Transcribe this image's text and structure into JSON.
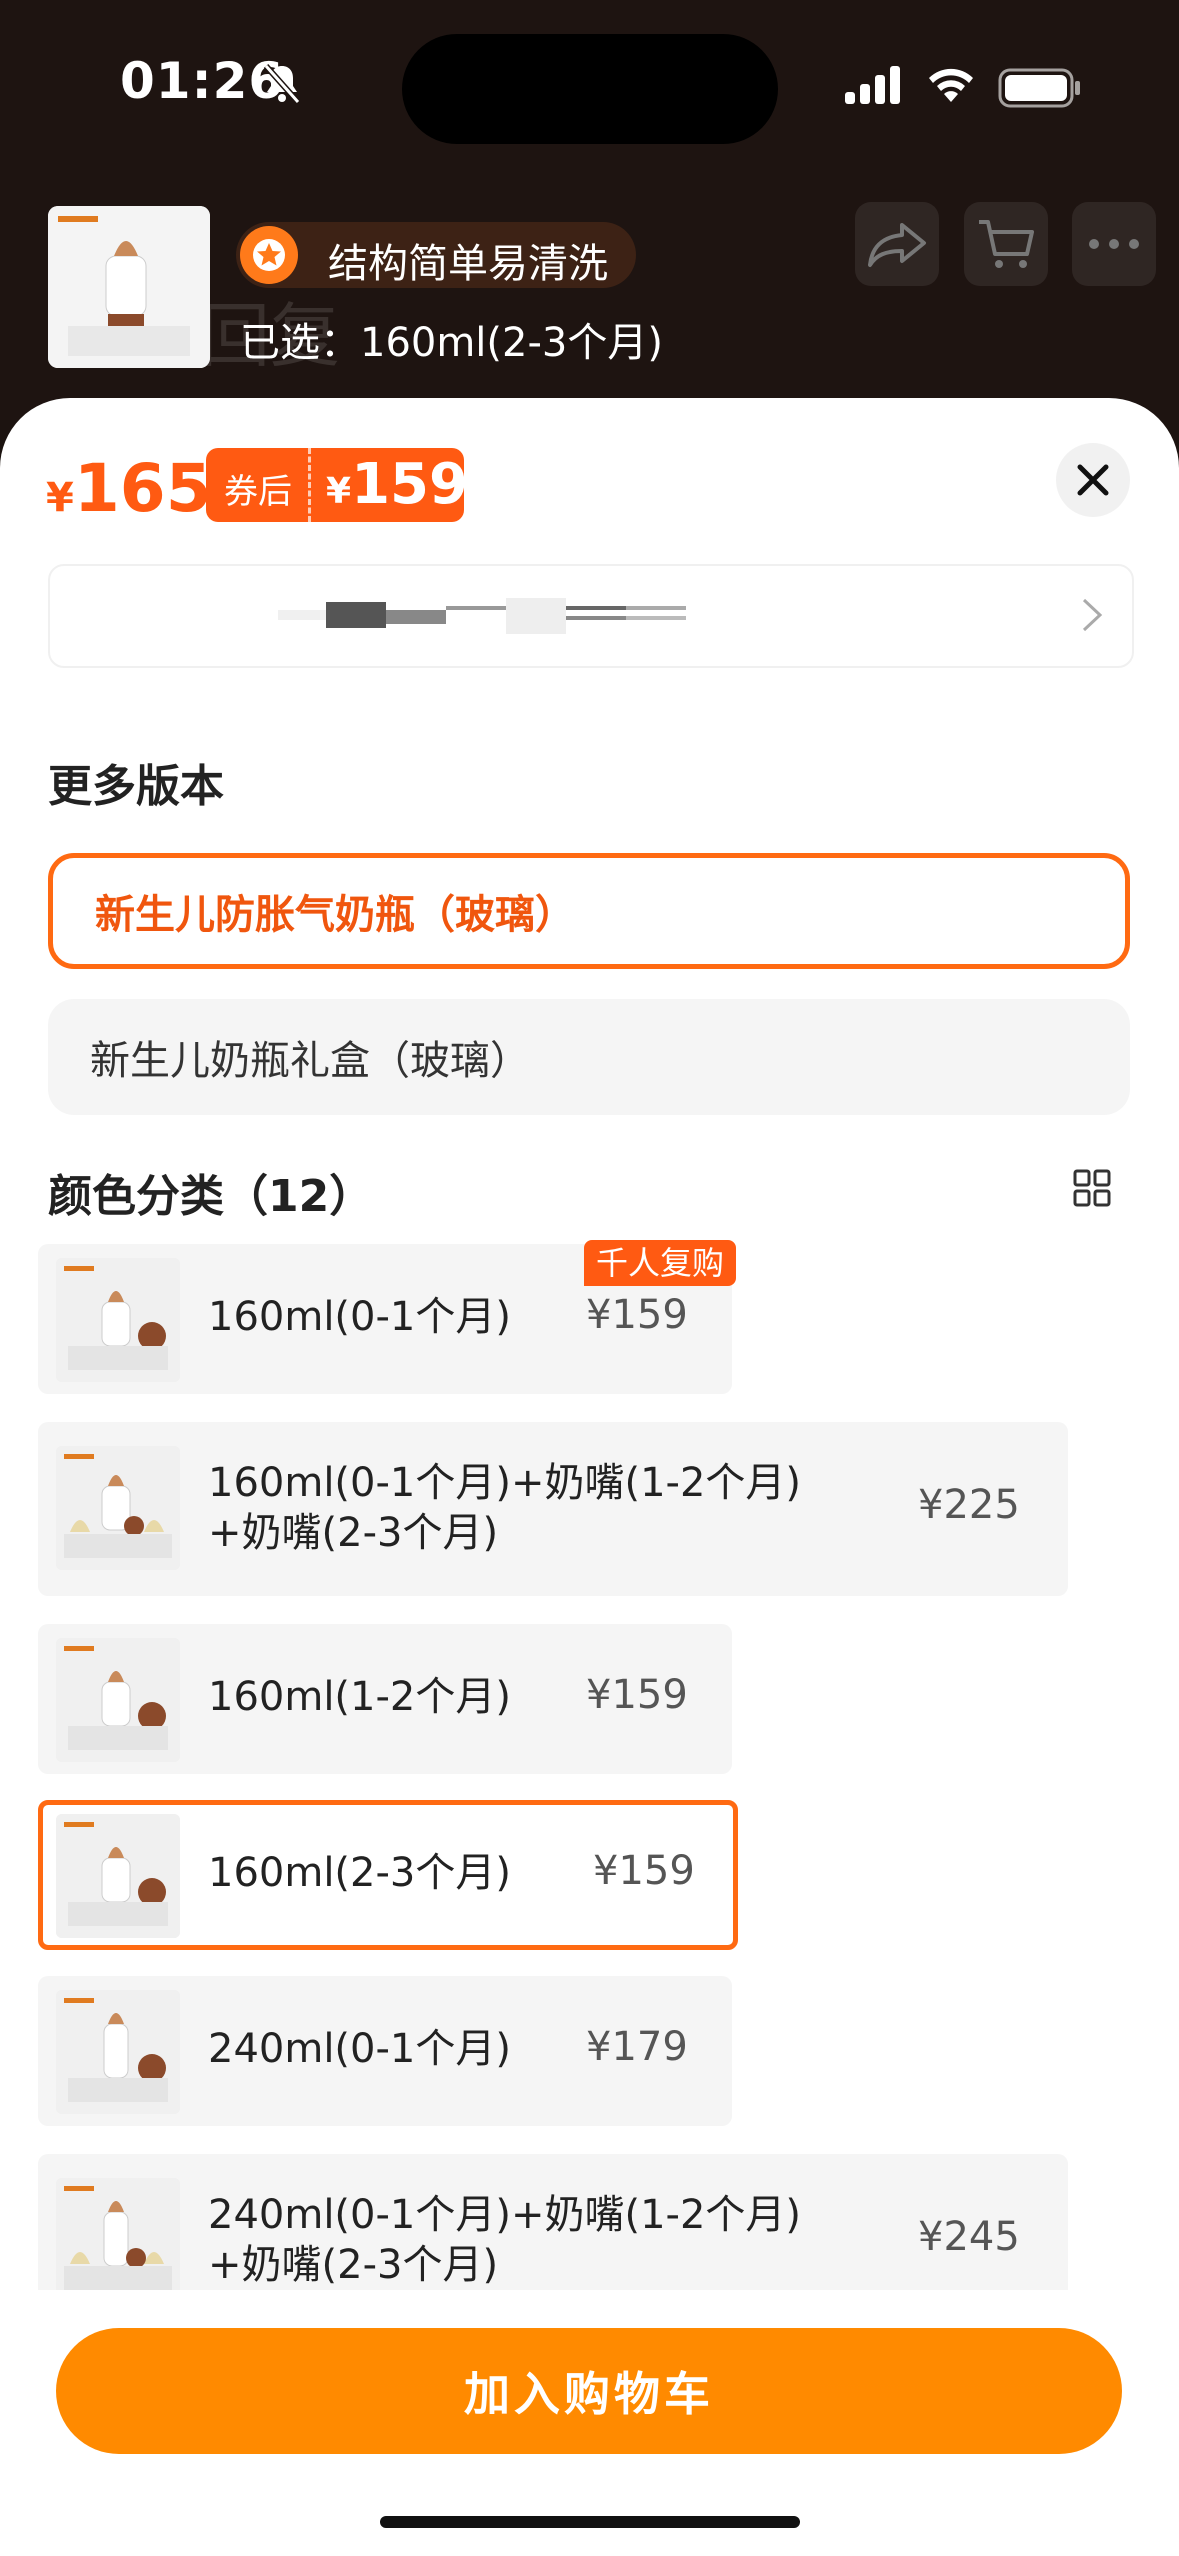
{
  "status_bar": {
    "time": "01:26"
  },
  "header": {
    "feature_text": "结构简单易清洗",
    "selected_label": "已选：160ml(2-3个月)",
    "watermark": "家部回复"
  },
  "price": {
    "currency": "¥",
    "current": "165",
    "coupon_label": "券后",
    "coupon_price": "159"
  },
  "versions": {
    "title": "更多版本",
    "items": [
      {
        "label": "新生儿防胀气奶瓶（玻璃）",
        "selected": true
      },
      {
        "label": "新生儿奶瓶礼盒（玻璃）",
        "selected": false
      }
    ]
  },
  "colors": {
    "title": "颜色分类（12）",
    "badge": "千人复购",
    "items": [
      {
        "line1": "160ml(0-1个月)",
        "line2": "",
        "price": "¥159"
      },
      {
        "line1": "160ml(0-1个月)+奶嘴(1-2个月)",
        "line2": "+奶嘴(2-3个月)",
        "price": "¥225"
      },
      {
        "line1": "160ml(1-2个月)",
        "line2": "",
        "price": "¥159"
      },
      {
        "line1": "160ml(2-3个月)",
        "line2": "",
        "price": "¥159"
      },
      {
        "line1": "240ml(0-1个月)",
        "line2": "",
        "price": "¥179"
      },
      {
        "line1": "240ml(0-1个月)+奶嘴(1-2个月)",
        "line2": "+奶嘴(2-3个月)",
        "price": "¥245"
      }
    ]
  },
  "cart_button": "加入购物车",
  "theme": {
    "accent": "#ff5a12",
    "button": "#ff8a00"
  }
}
